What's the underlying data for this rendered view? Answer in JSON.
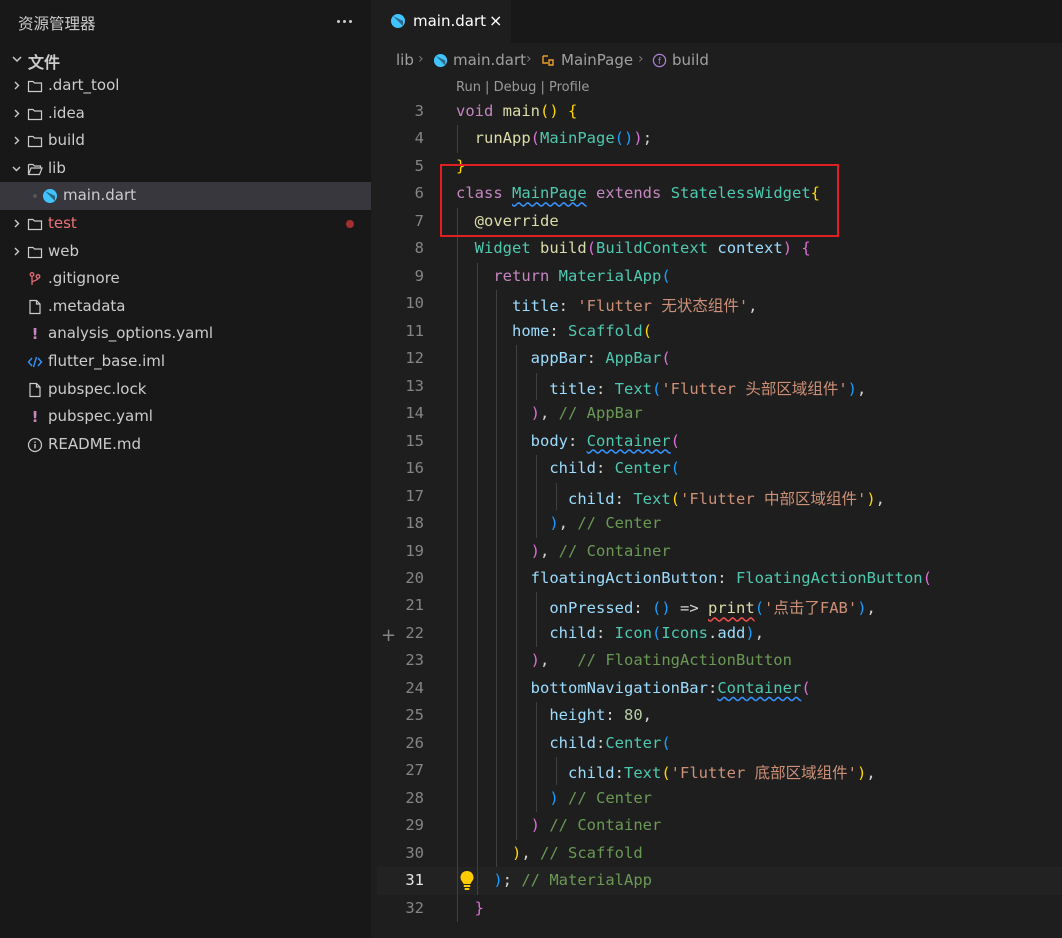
{
  "explorer": {
    "title": "资源管理器",
    "section_title": "文件",
    "items": [
      {
        "label": ".dart_tool",
        "type": "folder"
      },
      {
        "label": ".idea",
        "type": "folder"
      },
      {
        "label": "build",
        "type": "folder"
      },
      {
        "label": "lib",
        "type": "folder-open"
      },
      {
        "label": "main.dart",
        "type": "dart",
        "selected": true
      },
      {
        "label": "test",
        "type": "folder",
        "status": "error"
      },
      {
        "label": "web",
        "type": "folder"
      },
      {
        "label": ".gitignore",
        "type": "git"
      },
      {
        "label": ".metadata",
        "type": "file"
      },
      {
        "label": "analysis_options.yaml",
        "type": "yaml"
      },
      {
        "label": "flutter_base.iml",
        "type": "code"
      },
      {
        "label": "pubspec.lock",
        "type": "file"
      },
      {
        "label": "pubspec.yaml",
        "type": "yaml"
      },
      {
        "label": "README.md",
        "type": "info"
      }
    ]
  },
  "editor": {
    "tab": {
      "label": "main.dart",
      "close": "×"
    },
    "breadcrumb": [
      "lib",
      "main.dart",
      "MainPage",
      "build"
    ],
    "codelens": "Run | Debug | Profile",
    "current_line": 31,
    "lines": [
      {
        "n": "3",
        "text": "void main() {"
      },
      {
        "n": "4",
        "text": "  runApp(MainPage());"
      },
      {
        "n": "5",
        "text": "}"
      },
      {
        "n": "6",
        "text": "class MainPage extends StatelessWidget{"
      },
      {
        "n": "7",
        "text": "  @override"
      },
      {
        "n": "8",
        "text": "  Widget build(BuildContext context) {"
      },
      {
        "n": "9",
        "text": "    return MaterialApp("
      },
      {
        "n": "10",
        "text": "      title: 'Flutter 无状态组件',"
      },
      {
        "n": "11",
        "text": "      home: Scaffold("
      },
      {
        "n": "12",
        "text": "        appBar: AppBar("
      },
      {
        "n": "13",
        "text": "          title: Text('Flutter 头部区域组件'),"
      },
      {
        "n": "14",
        "text": "        ), // AppBar"
      },
      {
        "n": "15",
        "text": "        body: Container("
      },
      {
        "n": "16",
        "text": "          child: Center("
      },
      {
        "n": "17",
        "text": "            child: Text('Flutter 中部区域组件'),"
      },
      {
        "n": "18",
        "text": "          ), // Center"
      },
      {
        "n": "19",
        "text": "        ), // Container"
      },
      {
        "n": "20",
        "text": "        floatingActionButton: FloatingActionButton("
      },
      {
        "n": "21",
        "text": "          onPressed: () => print('点击了FAB'),"
      },
      {
        "n": "22",
        "text": "          child: Icon(Icons.add),"
      },
      {
        "n": "23",
        "text": "        ),   // FloatingActionButton"
      },
      {
        "n": "24",
        "text": "        bottomNavigationBar:Container("
      },
      {
        "n": "25",
        "text": "          height: 80,"
      },
      {
        "n": "26",
        "text": "          child:Center("
      },
      {
        "n": "27",
        "text": "            child:Text('Flutter 底部区域组件'),"
      },
      {
        "n": "28",
        "text": "          ) // Center"
      },
      {
        "n": "29",
        "text": "        ) // Container"
      },
      {
        "n": "30",
        "text": "      ), // Scaffold"
      },
      {
        "n": "31",
        "text": "    ); // MaterialApp"
      },
      {
        "n": "32",
        "text": "  }"
      }
    ]
  },
  "colors": {
    "keyword": "#c586c0",
    "function": "#dcdcaa",
    "type": "#4ec9b0",
    "string": "#ce9178",
    "comment": "#6a9955",
    "highlight_box": "#e02020"
  }
}
